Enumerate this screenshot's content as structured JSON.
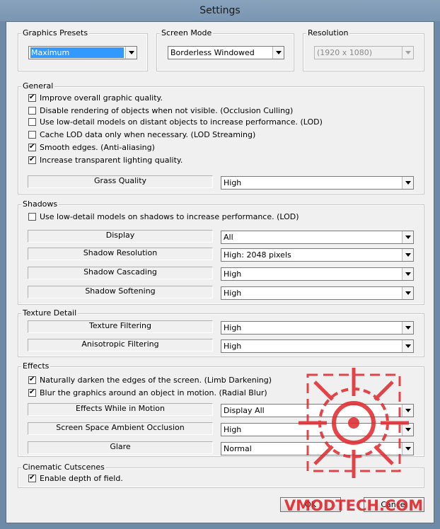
{
  "window": {
    "title": "Settings"
  },
  "presets": {
    "graphics": {
      "label": "Graphics Presets",
      "value": "Maximum"
    },
    "screen_mode": {
      "label": "Screen Mode",
      "value": "Borderless Windowed"
    },
    "resolution": {
      "label": "Resolution",
      "value": "(1920 x 1080)"
    }
  },
  "general": {
    "title": "General",
    "checks": [
      {
        "label": "Improve overall graphic quality.",
        "checked": true
      },
      {
        "label": "Disable rendering of objects when not visible. (Occlusion Culling)",
        "checked": false
      },
      {
        "label": "Use low-detail models on distant objects to increase performance. (LOD)",
        "checked": false
      },
      {
        "label": "Cache LOD data only when necessary. (LOD Streaming)",
        "checked": false
      },
      {
        "label": "Smooth edges. (Anti-aliasing)",
        "checked": true
      },
      {
        "label": "Increase transparent lighting quality.",
        "checked": true
      }
    ],
    "grass": {
      "label": "Grass Quality",
      "value": "High"
    }
  },
  "shadows": {
    "title": "Shadows",
    "check": {
      "label": "Use low-detail models on shadows to increase performance. (LOD)",
      "checked": false
    },
    "rows": [
      {
        "label": "Display",
        "value": "All"
      },
      {
        "label": "Shadow Resolution",
        "value": "High: 2048 pixels"
      },
      {
        "label": "Shadow Cascading",
        "value": "High"
      },
      {
        "label": "Shadow Softening",
        "value": "High"
      }
    ]
  },
  "texture": {
    "title": "Texture Detail",
    "rows": [
      {
        "label": "Texture Filtering",
        "value": "High"
      },
      {
        "label": "Anisotropic Filtering",
        "value": "High"
      }
    ]
  },
  "effects": {
    "title": "Effects",
    "checks": [
      {
        "label": "Naturally darken the edges of the screen. (Limb Darkening)",
        "checked": true
      },
      {
        "label": "Blur the graphics around an object in motion. (Radial Blur)",
        "checked": true
      }
    ],
    "rows": [
      {
        "label": "Effects While in Motion",
        "value": "Display All"
      },
      {
        "label": "Screen Space Ambient Occlusion",
        "value": "High"
      },
      {
        "label": "Glare",
        "value": "Normal"
      }
    ]
  },
  "cinematic": {
    "title": "Cinematic Cutscenes",
    "check": {
      "label": "Enable depth of field.",
      "checked": true
    }
  },
  "buttons": {
    "ok": "OK",
    "cancel": "Cancel"
  },
  "watermark": {
    "text": "VMODTECH.COM",
    "color": "#e0262b"
  }
}
